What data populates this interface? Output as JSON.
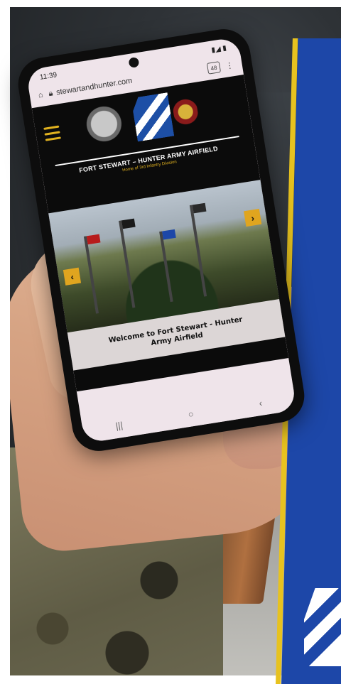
{
  "phone": {
    "status_time": "11:39",
    "url": "stewartandhunter.com",
    "tab_count": "48"
  },
  "site": {
    "title": "FORT STEWART – HUNTER ARMY AIRFIELD",
    "subtitle": "Home of 3rd Infantry Division",
    "welcome": "Welcome to Fort Stewart - Hunter Army Airfield",
    "prev_arrow": "‹",
    "next_arrow": "›"
  },
  "nav": {
    "recents": "|||",
    "home": "○",
    "back": "‹"
  },
  "colors": {
    "accent_gold": "#e0b11f",
    "division_blue": "#1d47a8",
    "site_bg": "#0b0b0b"
  },
  "icons": [
    "home-icon",
    "lock-icon",
    "menu-icon",
    "tabs-icon",
    "more-icon"
  ]
}
